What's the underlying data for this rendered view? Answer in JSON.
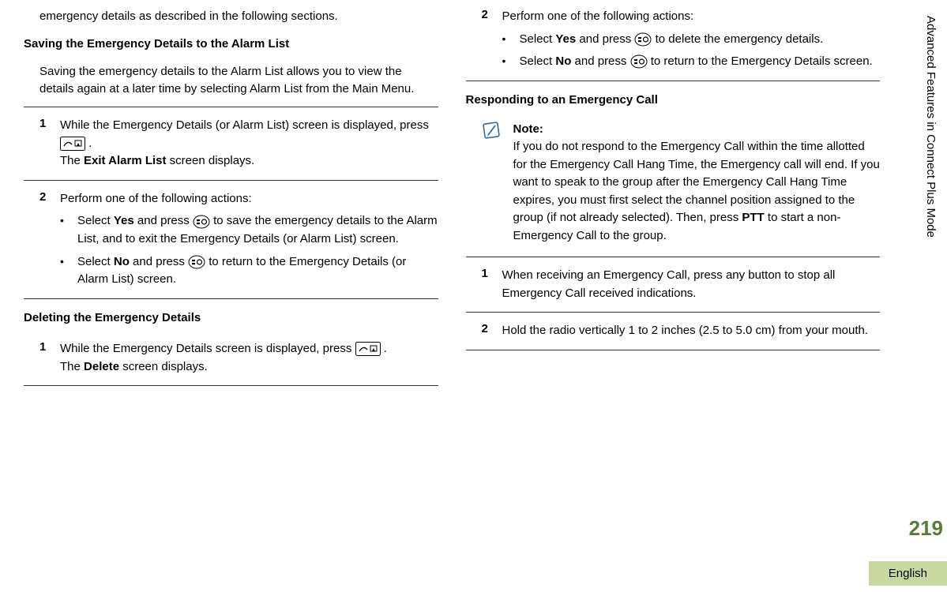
{
  "sidebar": {
    "chapter": "Advanced Features in Connect Plus Mode",
    "page_number": "219",
    "language": "English"
  },
  "col1": {
    "top_fragment": "emergency details as described in the following sections.",
    "h1": "Saving the Emergency Details to the Alarm List",
    "para1": "Saving the emergency details to the Alarm List allows you to view the details again at a later time by selecting Alarm List from the Main Menu.",
    "s1_num": "1",
    "s1_a": "While the Emergency Details (or Alarm List) screen is displayed, press ",
    "s1_b": ".",
    "s1_c_pre": "The ",
    "s1_c_bold": "Exit Alarm List",
    "s1_c_post": " screen displays.",
    "s2_num": "2",
    "s2_a": "Perform one of the following actions:",
    "s2_b1_pre": "Select ",
    "s2_b1_yes": "Yes",
    "s2_b1_mid": " and press ",
    "s2_b1_post": " to save the emergency details to the Alarm List, and to exit the Emergency Details (or Alarm List) screen.",
    "s2_b2_pre": "Select ",
    "s2_b2_no": "No",
    "s2_b2_mid": " and press ",
    "s2_b2_post": " to return to the Emergency Details (or Alarm List) screen.",
    "h2": "Deleting the Emergency Details",
    "d1_num": "1",
    "d1_a": "While the Emergency Details screen is displayed, press ",
    "d1_b": ".",
    "d1_c_pre": "The ",
    "d1_c_bold": "Delete",
    "d1_c_post": " screen displays."
  },
  "col2": {
    "s2_num": "2",
    "s2_a": "Perform one of the following actions:",
    "b1_pre": "Select ",
    "b1_yes": "Yes",
    "b1_mid": " and press ",
    "b1_post": " to delete the emergency details.",
    "b2_pre": "Select ",
    "b2_no": "No",
    "b2_mid": " and press ",
    "b2_post": " to return to the Emergency Details screen.",
    "h1": "Responding to an Emergency Call",
    "note_label": "Note:",
    "note_a": "If you do not respond to the Emergency Call within the time allotted for the Emergency Call Hang Time, the Emergency call will end. If you want to speak to the group after the Emergency Call Hang Time expires, you must first select the channel position assigned to the group (if not already selected). Then, press ",
    "note_ptt": "PTT",
    "note_b": " to start a non-Emergency Call to the group.",
    "r1_num": "1",
    "r1": "When receiving an Emergency Call, press any button to stop all Emergency Call received indications.",
    "r2_num": "2",
    "r2": "Hold the radio vertically 1 to 2 inches (2.5 to 5.0 cm) from your mouth."
  }
}
